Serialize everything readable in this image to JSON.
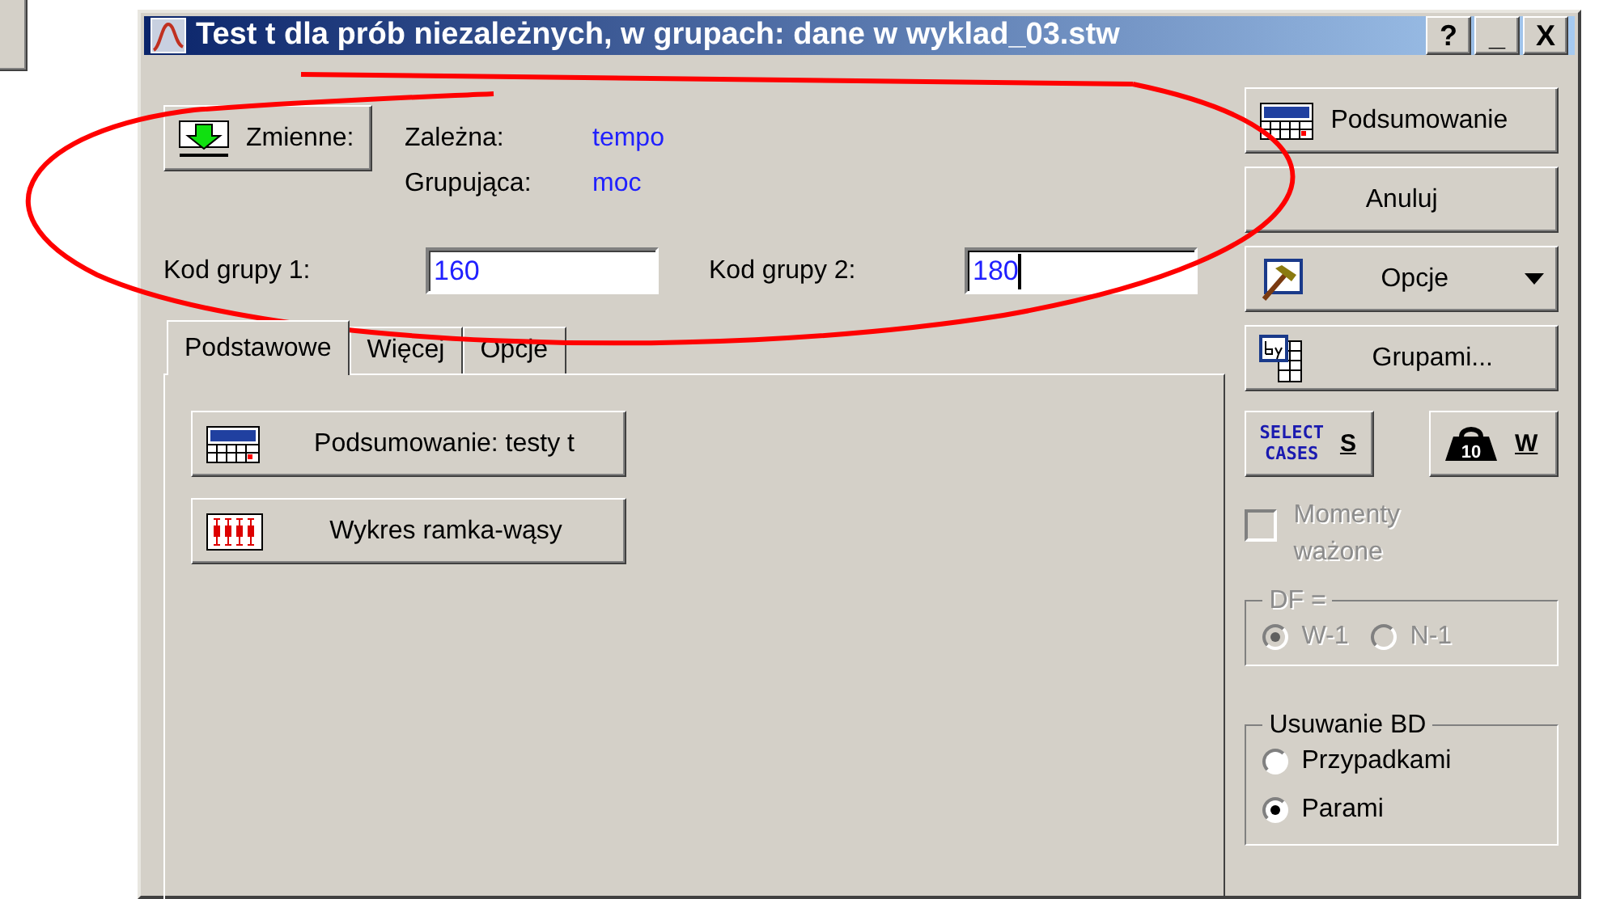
{
  "title": "Test t dla prób niezależnych, w grupach: dane w wyklad_03.stw",
  "title_buttons": [
    "?",
    "_",
    "X"
  ],
  "variables_button": "Zmienne:",
  "variables": [
    {
      "label": "Zależna:",
      "value": "tempo"
    },
    {
      "label": "Grupująca:",
      "value": "moc"
    }
  ],
  "group_codes": [
    {
      "label": "Kod grupy 1:",
      "value": "160",
      "focused": false
    },
    {
      "label": "Kod grupy 2:",
      "value": "180",
      "focused": true
    }
  ],
  "tabs": [
    {
      "label": "Podstawowe",
      "selected": true
    },
    {
      "label": "Więcej",
      "selected": false
    },
    {
      "label": "Opcje",
      "selected": false
    }
  ],
  "panel_buttons": [
    {
      "label": "Podsumowanie: testy t",
      "kind": "summary"
    },
    {
      "label": "Wykres ramka-wąsy",
      "kind": "boxplot"
    }
  ],
  "side_buttons": [
    {
      "label": "Podsumowanie",
      "kind": "summary"
    },
    {
      "label": "Anuluj",
      "kind": "plain"
    },
    {
      "label": "Opcje",
      "kind": "options"
    },
    {
      "label": "Grupami...",
      "kind": "bygroup"
    }
  ],
  "select_cases": {
    "icon_text": [
      "SELECT",
      "CASES"
    ],
    "label": "S"
  },
  "weight": {
    "icon_text": "10",
    "label": "W"
  },
  "weighted_moments": {
    "label": "Momenty ważone",
    "checked": false,
    "disabled": true
  },
  "df": {
    "label": "DF =",
    "disabled": true,
    "options": [
      {
        "label": "W-1",
        "selected": true
      },
      {
        "label": "N-1",
        "selected": false
      }
    ]
  },
  "missing_data": {
    "label": "Usuwanie BD",
    "disabled": false,
    "options": [
      {
        "label": "Przypadkami",
        "selected": false
      },
      {
        "label": "Parami",
        "selected": true
      }
    ]
  }
}
